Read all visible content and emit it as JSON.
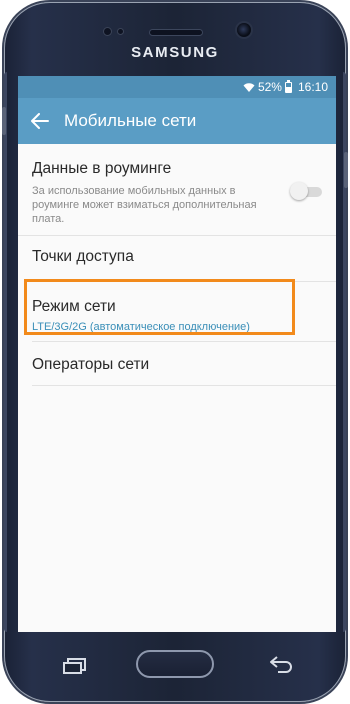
{
  "device": {
    "brand": "SAMSUNG"
  },
  "status_bar": {
    "battery": "52%",
    "time": "16:10",
    "icons": [
      "wifi-icon",
      "battery-icon"
    ]
  },
  "app_bar": {
    "title": "Мобильные сети",
    "back_icon": "arrow-left-icon"
  },
  "settings": [
    {
      "title": "Данные в роуминге",
      "subtitle": "За использование мобильных данных в роуминге может взиматься дополнительная плата.",
      "toggle": "off"
    },
    {
      "title": "Точки доступа"
    },
    {
      "title": "Режим сети",
      "subtitle": "LTE/3G/2G (автоматическое подключение)",
      "highlighted": true
    },
    {
      "title": "Операторы сети"
    }
  ],
  "colors": {
    "status_bar": "#4f8fb6",
    "app_bar": "#5a9dc5",
    "accent_text": "#3b8fb8",
    "highlight_border": "#f28a1b",
    "phone_body": "#1c2436"
  }
}
